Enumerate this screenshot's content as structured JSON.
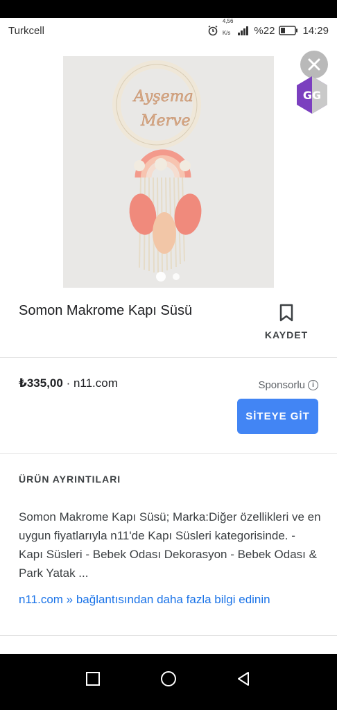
{
  "status_bar": {
    "carrier": "Turkcell",
    "network_speed_top": "4,56",
    "network_speed_bottom": "K/s",
    "battery_percent": "%22",
    "time": "14:29"
  },
  "product": {
    "title": "Somon Makrome Kapı Süsü",
    "save_label": "KAYDET",
    "price": "₺335,00",
    "separator_store": "· n11.com",
    "sponsored_label": "Sponsorlu",
    "site_button_label": "SİTEYE GİT"
  },
  "image_text": {
    "name_top": "Ayşema",
    "name_bottom": "Merve",
    "gg_letters": "GG"
  },
  "details": {
    "heading": "ÜRÜN AYRINTILARI",
    "description": "Somon Makrome Kapı Süsü; Marka:Diğer özellikleri ve en uygun fiyatlarıyla n11'de Kapı Süsleri kategorisinde. - Kapı Süsleri - Bebek Odası Dekorasyon - Bebek Odası & Park Yatak ...",
    "more_link": "n11.com » bağlantısından daha fazla bilgi edinin"
  },
  "icons": {
    "alarm": "alarm-icon",
    "signal": "signal-icon",
    "battery": "battery-icon",
    "close": "close-icon",
    "bookmark": "bookmark-icon",
    "info": "info-icon",
    "recent_apps": "recent-apps-icon",
    "home": "home-icon",
    "back": "back-icon"
  },
  "colors": {
    "accent_button": "#4285f4",
    "link": "#1a73e8",
    "salmon_leaf": "#f08a7c",
    "peach_leaf": "#f2c6a7",
    "gg_purple": "#7b3fbf"
  }
}
